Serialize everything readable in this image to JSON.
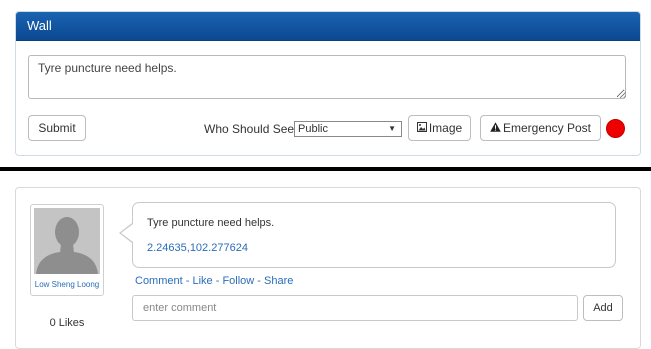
{
  "wall": {
    "title": "Wall",
    "post_text": "Tyre puncture need helps.",
    "submit_label": "Submit",
    "visibility_label": "Who Should See:",
    "visibility_value": "Public",
    "image_label": "Image",
    "emergency_label": "Emergency Post",
    "status_color": "#ee0000"
  },
  "post": {
    "author": "Low Sheng Loong",
    "likes": "0 Likes",
    "text": "Tyre puncture need helps.",
    "coords": "2.24635,102.277624",
    "actions": {
      "comment": "Comment",
      "like": "Like",
      "follow": "Follow",
      "share": "Share",
      "separator": " - "
    },
    "comment_placeholder": "enter comment",
    "add_label": "Add"
  },
  "icons": {
    "image": "image-icon",
    "emergency": "warning-icon",
    "dropdown": "chevron-down-icon"
  }
}
